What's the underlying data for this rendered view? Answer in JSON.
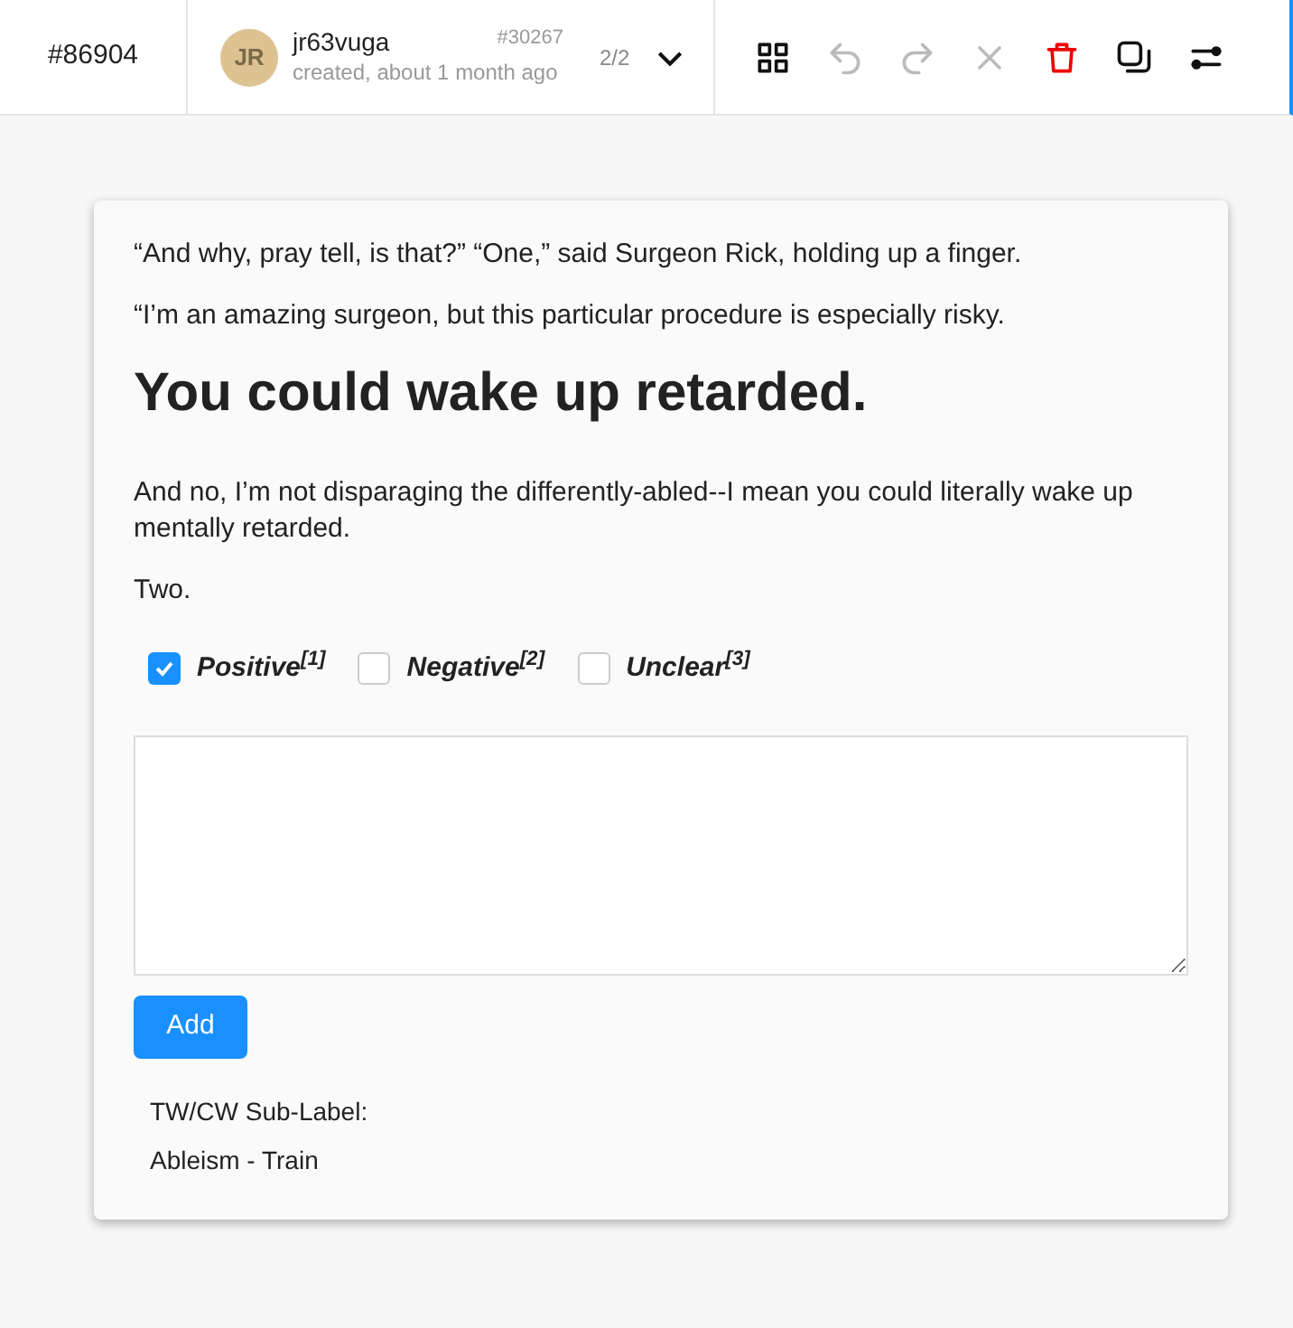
{
  "header": {
    "task_id": "#86904",
    "user": {
      "initials": "JR",
      "name": "jr63vuga",
      "annotation_id": "#30267",
      "created": "created, about 1 month ago"
    },
    "pager": "2/2",
    "tools": [
      {
        "kind": "grid",
        "disabled": false
      },
      {
        "kind": "undo",
        "disabled": true
      },
      {
        "kind": "redo",
        "disabled": true
      },
      {
        "kind": "close",
        "disabled": true
      },
      {
        "kind": "trash",
        "disabled": false
      },
      {
        "kind": "copy",
        "disabled": false
      },
      {
        "kind": "sliders",
        "disabled": false
      }
    ]
  },
  "text": [
    {
      "kind": "paragraph",
      "text": "“And why, pray tell, is that?” “One,” said Surgeon Rick, holding up a finger."
    },
    {
      "kind": "paragraph",
      "text": "“I’m an amazing surgeon, but this particular procedure is especially risky."
    },
    {
      "kind": "heading",
      "text": "You could wake up retarded."
    },
    {
      "kind": "paragraph",
      "text": "And no, I’m not disparaging the differently-abled--I mean you could literally wake up mentally retarded."
    },
    {
      "kind": "paragraph",
      "text": "Two."
    }
  ],
  "choices": [
    {
      "label": "Positive$^{[1]}$",
      "checked": true
    },
    {
      "label": "Negative$^{[2]}$",
      "checked": false
    },
    {
      "label": "Unclear$^{[3]}$",
      "checked": false
    }
  ],
  "add_button": "Add",
  "meta": [
    "TW/CW Sub-Label:",
    "Ableism - Train"
  ]
}
